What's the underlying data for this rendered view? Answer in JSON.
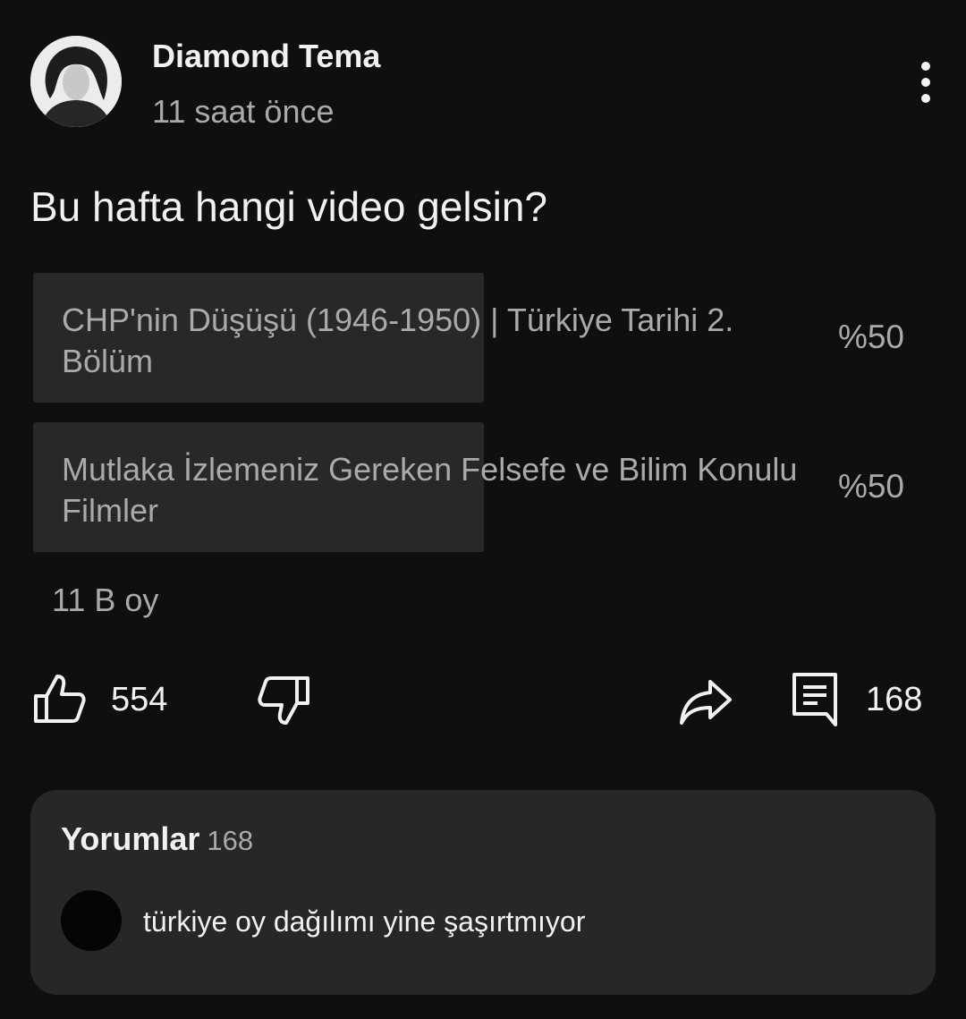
{
  "post": {
    "channel_name": "Diamond Tema",
    "timestamp": "11 saat önce",
    "question": "Bu hafta hangi video gelsin?"
  },
  "poll": {
    "options": [
      {
        "label": "CHP'nin Düşüşü (1946-1950) | Türkiye Tarihi 2. Bölüm",
        "percent_label": "%50",
        "percent": 50
      },
      {
        "label": "Mutlaka İzlemeniz Gereken Felsefe ve Bilim Konulu Filmler",
        "percent_label": "%50",
        "percent": 50
      }
    ],
    "vote_count": "11 B oy"
  },
  "actions": {
    "like_count": "554",
    "comments_count": "168",
    "icons": [
      "thumbs-up-icon",
      "thumbs-down-icon",
      "share-icon",
      "comment-icon",
      "more-vertical-icon"
    ]
  },
  "comments": {
    "title": "Yorumlar",
    "count": "168",
    "top_comment": "türkiye oy dağılımı yine şaşırtmıyor"
  },
  "colors": {
    "background": "#0f0f0f",
    "poll_fill": "#282828",
    "panel": "#272727",
    "text_primary": "#f1f1f1",
    "text_secondary": "#aaaaaa"
  }
}
